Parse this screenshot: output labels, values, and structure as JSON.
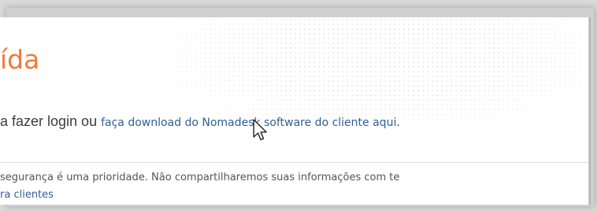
{
  "heading": "ída",
  "login_line": {
    "lead": "a fazer login ou ",
    "link": "faça download do Nomadesk software do cliente aqui",
    "end": "."
  },
  "security_note": "segurança é uma prioridade. Não compartilharemos suas informações com te",
  "clients_link": "ra clientes",
  "colors": {
    "heading": "#f07a3a",
    "link": "#2f5f93"
  },
  "icons": {
    "cursor": "mouse-pointer-icon"
  }
}
